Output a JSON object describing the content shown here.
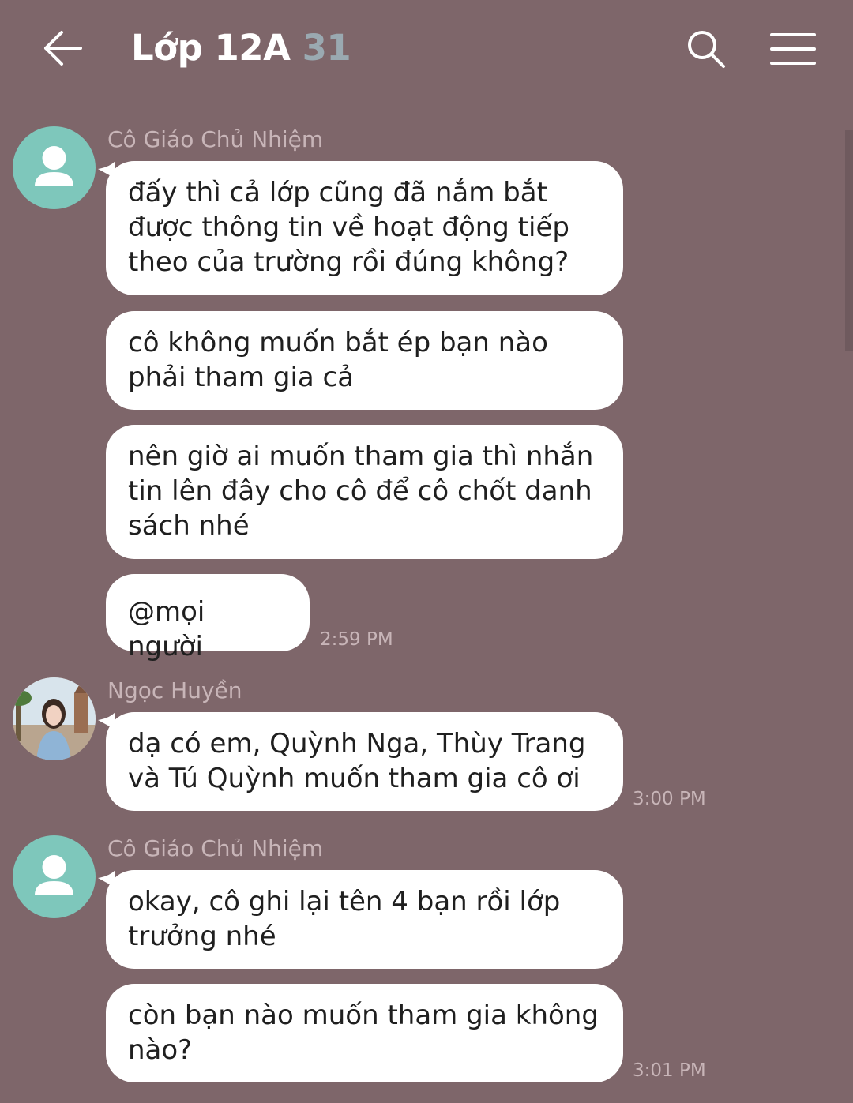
{
  "header": {
    "title": "Lớp 12A",
    "member_count": "31",
    "back_icon": "arrow-left-icon",
    "search_icon": "search-icon",
    "menu_icon": "hamburger-menu-icon"
  },
  "colors": {
    "background": "#7e666a",
    "bubble": "#ffffff",
    "avatar_default": "#7ec7bb",
    "member_count": "#9aa9b1"
  },
  "messages": [
    {
      "sender": "Cô Giáo Chủ Nhiệm",
      "bubbles": [
        "đấy thì cả lớp cũng đã nắm bắt được thông tin về hoạt động tiếp theo của trường rồi đúng không?",
        "cô không muốn bắt ép bạn nào phải tham gia cả",
        "nên giờ ai muốn tham gia thì nhắn tin lên đây cho cô để cô chốt danh sách nhé",
        "@mọi người"
      ],
      "time": "2:59 PM"
    },
    {
      "sender": "Ngọc Huyền",
      "bubbles": [
        "dạ có em, Quỳnh Nga, Thùy Trang và Tú Quỳnh muốn tham gia cô ơi"
      ],
      "time": "3:00 PM"
    },
    {
      "sender": "Cô Giáo Chủ Nhiệm",
      "bubbles": [
        "okay, cô ghi lại tên 4 bạn rồi lớp trưởng nhé",
        "còn bạn nào muốn tham gia không nào?"
      ],
      "time": "3:01 PM"
    }
  ]
}
